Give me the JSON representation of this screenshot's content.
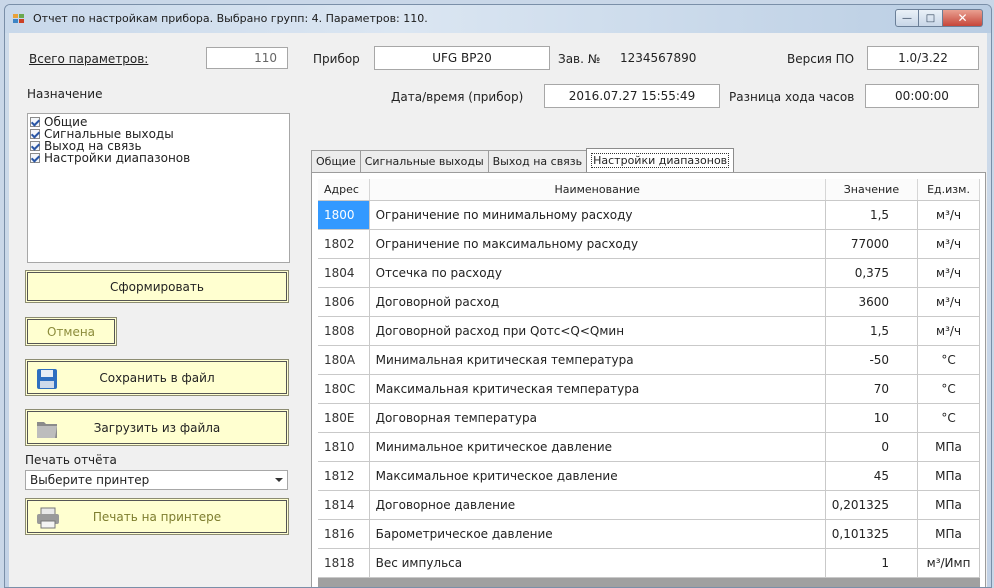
{
  "window": {
    "title": "Отчет по настройкам прибора. Выбрано групп: 4. Параметров: 110.",
    "minimize_glyph": "—",
    "maximize_glyph": "□",
    "close_glyph": "✕"
  },
  "left": {
    "total_label": "Всего параметров:",
    "total_value": "110",
    "purpose_label": "Назначение",
    "groups": [
      {
        "label": "Общие",
        "checked": true
      },
      {
        "label": "Сигнальные выходы",
        "checked": true
      },
      {
        "label": "Выход на связь",
        "checked": true
      },
      {
        "label": "Настройки диапазонов",
        "checked": true
      }
    ],
    "generate_button": "Сформировать",
    "cancel_button": "Отмена",
    "save_button": "Сохранить в файл",
    "load_button": "Загрузить из файла",
    "print_label": "Печать отчёта",
    "printer_select": "Выберите принтер",
    "print_button": "Печать на принтере"
  },
  "device": {
    "device_label": "Прибор",
    "device_value": "UFG BP20",
    "serial_label": "Зав. №",
    "serial_value": "1234567890",
    "firmware_label": "Версия ПО",
    "firmware_value": "1.0/3.22",
    "datetime_label": "Дата/время (прибор)",
    "datetime_value": "2016.07.27 15:55:49",
    "clockdiff_label": "Разница хода часов",
    "clockdiff_value": "00:00:00"
  },
  "tabs": [
    "Общие",
    "Сигнальные выходы",
    "Выход на связь",
    "Настройки диапазонов"
  ],
  "active_tab": 3,
  "table": {
    "headers": [
      "Адрес",
      "Наименование",
      "Значение",
      "Ед.изм."
    ],
    "rows": [
      [
        "1800",
        "Ограничение по минимальному расходу",
        "1,5",
        "м³/ч"
      ],
      [
        "1802",
        "Ограничение по максимальному расходу",
        "77000",
        "м³/ч"
      ],
      [
        "1804",
        "Отсечка по расходу",
        "0,375",
        "м³/ч"
      ],
      [
        "1806",
        "Договорной расход",
        "3600",
        "м³/ч"
      ],
      [
        "1808",
        "Договорной расход при Qотс<Q<Qмин",
        "1,5",
        "м³/ч"
      ],
      [
        "180A",
        "Минимальная критическая температура",
        "-50",
        "°C"
      ],
      [
        "180C",
        "Максимальная критическая температура",
        "70",
        "°C"
      ],
      [
        "180E",
        "Договорная температура",
        "10",
        "°C"
      ],
      [
        "1810",
        "Минимальное критическое давление",
        "0",
        "МПа"
      ],
      [
        "1812",
        "Максимальное критическое давление",
        "45",
        "МПа"
      ],
      [
        "1814",
        "Договорное давление",
        "0,201325",
        "МПа"
      ],
      [
        "1816",
        "Барометрическое давление",
        "0,101325",
        "МПа"
      ],
      [
        "1818",
        "Вес импульса",
        "1",
        "м³/Имп"
      ]
    ],
    "selected_row": 0
  }
}
